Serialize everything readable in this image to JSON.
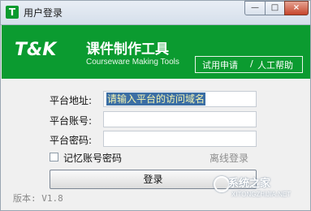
{
  "window": {
    "title": "用户登录",
    "app_icon_text": "T",
    "controls": {
      "minimize": "—",
      "maximize": "□",
      "close": "×"
    }
  },
  "banner": {
    "logo": "T&K",
    "brand": "课件制作工具",
    "subtitle": "Courseware Making Tools",
    "apply_link": "试用申请",
    "separator": "/",
    "human_help_link": "人工帮助",
    "color": "#0b9b30"
  },
  "form": {
    "address_label": "平台地址:",
    "address_value": "请输入平台的访问域名",
    "account_label": "平台账号:",
    "account_value": "",
    "password_label": "平台密码:",
    "password_value": "",
    "remember_label": "记忆账号密码",
    "remember_checked": false,
    "offline_link": "离线登录",
    "login_button": "登录"
  },
  "footer": {
    "version": "版本: V1.8"
  },
  "watermark": {
    "text": "系统之家",
    "url": "XITONGZHIJIA.NET"
  }
}
